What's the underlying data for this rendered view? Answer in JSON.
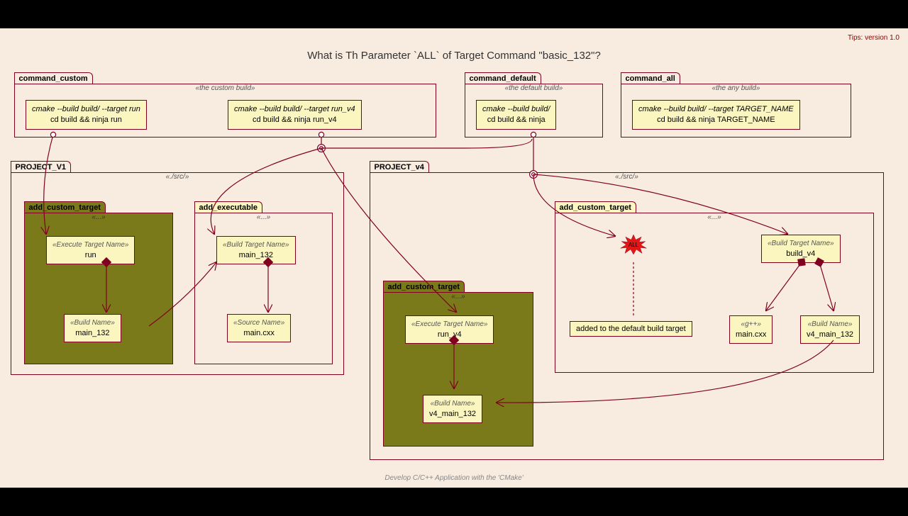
{
  "meta": {
    "tips": "Tips: version 1.0",
    "title": "What is Th Parameter `ALL` of Target Command \"basic_132\"?",
    "footer": "Develop C/C++ Application with the 'CMake'"
  },
  "packages": {
    "command_custom": {
      "name": "command_custom",
      "stereo": "«the custom build»"
    },
    "command_default": {
      "name": "command_default",
      "stereo": "«the default build»"
    },
    "command_all": {
      "name": "command_all",
      "stereo": "«the any build»"
    },
    "project_v1": {
      "name": "PROJECT_V1",
      "stereo": "«./src/»"
    },
    "project_v4": {
      "name": "PROJECT_v4",
      "stereo": "«./src/»"
    },
    "add_custom_target_v1": {
      "name": "add_custom_target",
      "stereo": "«...»"
    },
    "add_executable": {
      "name": "add_executable",
      "stereo": "«...»"
    },
    "add_custom_target_v4": {
      "name": "add_custom_target",
      "stereo": "«...»"
    },
    "add_custom_target_v4b": {
      "name": "add_custom_target",
      "stereo": "«...»"
    }
  },
  "commands": {
    "c1": {
      "l1": "cmake --build build/ --target run",
      "l2": "cd build && ninja run"
    },
    "c2": {
      "l1": "cmake --build build/ --target run_v4",
      "l2": "cd build && ninja run_v4"
    },
    "c3": {
      "l1": "cmake --build build/",
      "l2": "cd build && ninja"
    },
    "c4": {
      "l1": "cmake --build build/ --target TARGET_NAME",
      "l2": "cd build && ninja TARGET_NAME"
    }
  },
  "nodes": {
    "run": {
      "stereo": "«Execute Target Name»",
      "name": "run"
    },
    "main_132": {
      "stereo": "«Build Name»",
      "name": "main_132"
    },
    "build_tgt": {
      "stereo": "«Build Target Name»",
      "name": "main_132"
    },
    "main_cxx": {
      "stereo": "«Source Name»",
      "name": "main.cxx"
    },
    "run_v4": {
      "stereo": "«Execute Target Name»",
      "name": "run_v4"
    },
    "v4_main": {
      "stereo": "«Build Name»",
      "name": "v4_main_132"
    },
    "build_v4": {
      "stereo": "«Build Target Name»",
      "name": "build_v4"
    },
    "gpp": {
      "stereo": "«g++»",
      "name": "main.cxx"
    },
    "v4_main2": {
      "stereo": "«Build Name»",
      "name": "v4_main_132"
    },
    "all": {
      "name": "ALL"
    }
  },
  "notes": {
    "all_note": "added to the default build target"
  }
}
